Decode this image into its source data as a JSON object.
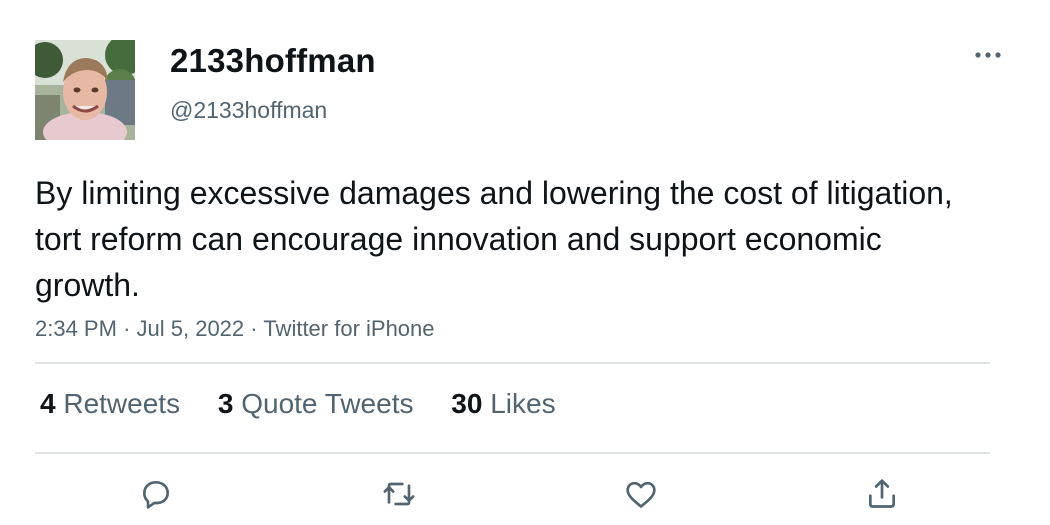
{
  "tweet": {
    "author": {
      "display_name": "2133hoffman",
      "handle": "@2133hoffman"
    },
    "text": "By limiting excessive damages and lowering the cost of litigation, tort reform can encourage innovation and support economic growth.",
    "time": "2:34 PM",
    "separator": "·",
    "date": "Jul 5, 2022",
    "source": "Twitter for iPhone"
  },
  "stats": {
    "retweets": {
      "count": "4",
      "label": "Retweets"
    },
    "quote_tweets": {
      "count": "3",
      "label": "Quote Tweets"
    },
    "likes": {
      "count": "30",
      "label": "Likes"
    }
  },
  "icons": {
    "more": "more-icon",
    "reply": "reply-icon",
    "retweet": "retweet-icon",
    "like": "like-icon",
    "share": "share-icon"
  },
  "colors": {
    "text_primary": "#0f1419",
    "text_secondary": "#536471",
    "divider": "#e1e4e7"
  }
}
